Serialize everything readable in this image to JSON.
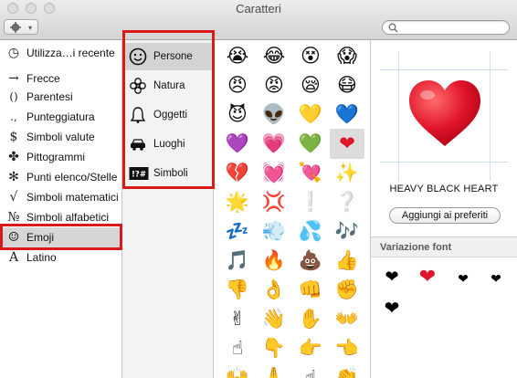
{
  "window": {
    "title": "Caratteri"
  },
  "toolbar": {
    "gear_icon": "gear-icon",
    "search_placeholder": ""
  },
  "categories": [
    {
      "icon": "clock-icon",
      "glyph": "◷",
      "label": "Utilizza…i recente"
    },
    {
      "icon": "arrow-icon",
      "glyph": "→",
      "label": "Frecce"
    },
    {
      "icon": "parentheses-icon",
      "glyph": "()",
      "label": "Parentesi"
    },
    {
      "icon": "punctuation-icon",
      "glyph": ".,",
      "label": "Punteggiatura"
    },
    {
      "icon": "currency-icon",
      "glyph": "$",
      "label": "Simboli valute"
    },
    {
      "icon": "pictograph-icon",
      "glyph": "✤",
      "label": "Pittogrammi"
    },
    {
      "icon": "bullet-icon",
      "glyph": "✻",
      "label": "Punti elenco/Stelle"
    },
    {
      "icon": "math-icon",
      "glyph": "√",
      "label": "Simboli matematici"
    },
    {
      "icon": "letterlike-icon",
      "glyph": "№",
      "label": "Simboli alfabetici"
    },
    {
      "icon": "smiley-icon",
      "glyph": "☺",
      "label": "Emoji",
      "selected": true
    },
    {
      "icon": "latin-icon",
      "glyph": "A",
      "label": "Latino"
    }
  ],
  "subcategories": [
    {
      "icon": "smiley-face-icon",
      "label": "Persone",
      "selected": true
    },
    {
      "icon": "flower-icon",
      "label": "Natura"
    },
    {
      "icon": "bell-icon",
      "label": "Oggetti"
    },
    {
      "icon": "car-icon",
      "label": "Luoghi"
    },
    {
      "icon": "symbols-icon",
      "label": "Simboli"
    }
  ],
  "emoji_grid": [
    [
      "😭",
      "😂",
      "😵",
      "😱"
    ],
    [
      "😠",
      "😡",
      "😪",
      "😷"
    ],
    [
      "😈",
      "👽",
      "💛",
      "💙"
    ],
    [
      "💜",
      "💗",
      "💚",
      "❤"
    ],
    [
      "💔",
      "💓",
      "💘",
      "✨"
    ],
    [
      "🌟",
      "💢",
      "❕",
      "❔"
    ],
    [
      "💤",
      "💨",
      "💦",
      "🎶"
    ],
    [
      "🎵",
      "🔥",
      "💩",
      "👍"
    ],
    [
      "👎",
      "👌",
      "👊",
      "✊"
    ],
    [
      "✌",
      "👋",
      "✋",
      "👐"
    ],
    [
      "☝",
      "👇",
      "👉",
      "👈"
    ],
    [
      "🙌",
      "🙏",
      "☝",
      "👏"
    ]
  ],
  "selected_emoji": "❤",
  "detail": {
    "character_name": "HEAVY BLACK HEART",
    "add_favorites_label": "Aggiungi ai preferiti",
    "font_variation_label": "Variazione font",
    "variants": [
      "❤",
      "❤",
      "❤",
      "❤",
      "❤"
    ],
    "heart_color": "#e0142a"
  },
  "colors": {
    "highlight_box": "#d81a1a",
    "selection_bg": "#d6d6d6"
  }
}
